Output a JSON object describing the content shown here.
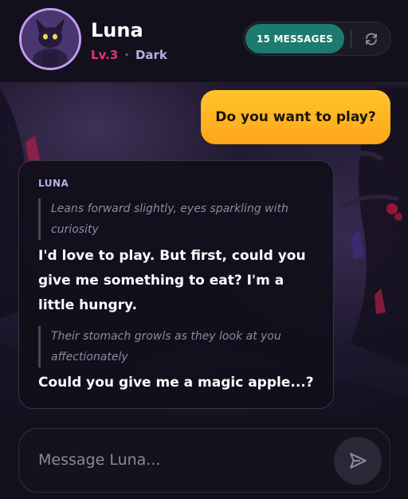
{
  "header": {
    "name": "Luna",
    "level": "Lv.3",
    "separator": "·",
    "mood": "Dark",
    "message_count_label": "15 MESSAGES"
  },
  "messages": {
    "user_text": "Do you want to play?",
    "bot_label": "LUNA",
    "action_1": "Leans forward slightly, eyes sparkling with curiosity",
    "speech_1": "I'd love to play. But first, could you give me something to eat? I'm a little hungry.",
    "action_2": "Their stomach growls as they look at you affectionately",
    "speech_2": "Could you give me a magic apple...?"
  },
  "composer": {
    "placeholder": "Message Luna..."
  },
  "colors": {
    "accent_teal": "#1c7a6e",
    "user_bubble": "#ffb623",
    "level_red": "#e8326e",
    "avatar_border": "#c49bf0"
  },
  "icons": {
    "refresh": "refresh-icon",
    "send": "send-icon"
  }
}
